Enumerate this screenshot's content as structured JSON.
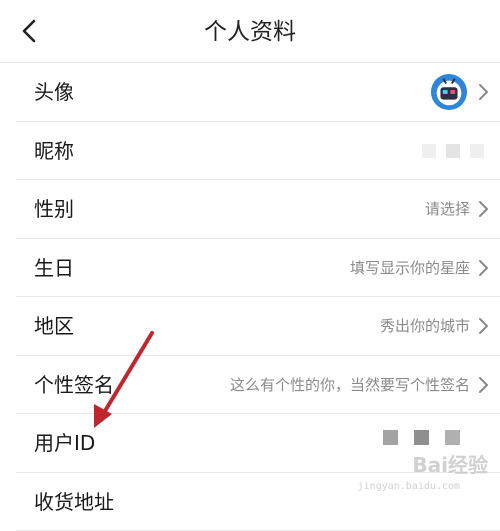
{
  "header": {
    "title": "个人资料",
    "back_icon": "chevron-left-icon"
  },
  "rows": [
    {
      "label": "头像",
      "value": "",
      "icon": "robot-avatar-icon"
    },
    {
      "label": "昵称",
      "value": ""
    },
    {
      "label": "性别",
      "value": "请选择"
    },
    {
      "label": "生日",
      "value": "填写显示你的星座"
    },
    {
      "label": "地区",
      "value": "秀出你的城市"
    },
    {
      "label": "个性签名",
      "value": "这么有个性的你，当然要写个性签名"
    },
    {
      "label": "用户ID",
      "value": ""
    },
    {
      "label": "收货地址",
      "value": ""
    }
  ],
  "watermark": {
    "brand": "Bai经验",
    "url": "jingyan.baidu.com"
  },
  "colors": {
    "annotation_arrow": "#c0262d",
    "avatar_ring": "#2f86d8",
    "value_text": "#8a8a8a"
  }
}
